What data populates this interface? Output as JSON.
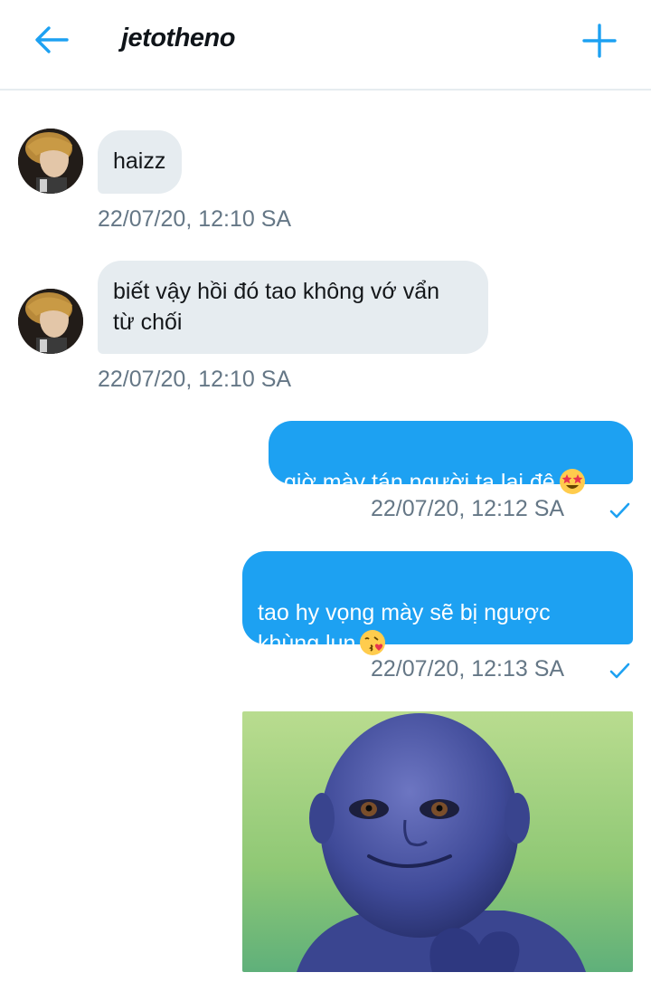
{
  "header": {
    "title": "jetotheno",
    "back_icon": "arrow-left-icon",
    "add_icon": "plus-icon"
  },
  "colors": {
    "accent": "#1da1f2",
    "incoming_bubble": "#e6ecf0",
    "timestamp": "#657786"
  },
  "messages": [
    {
      "direction": "incoming",
      "text": "haizz",
      "timestamp": "22/07/20, 12:10 SA"
    },
    {
      "direction": "incoming",
      "text": "biết vậy hồi đó tao không vớ vẩn\ntừ chối",
      "timestamp": "22/07/20, 12:10 SA"
    },
    {
      "direction": "outgoing",
      "text": "giờ mày tán người ta lại đê",
      "emoji": "star-struck-emoji",
      "timestamp": "22/07/20, 12:12 SA",
      "status_icon": "check-icon"
    },
    {
      "direction": "outgoing",
      "text": "tao hy vọng mày sẽ bị ngược\nkhùng lun",
      "emoji": "kissing-heart-emoji",
      "timestamp": "22/07/20, 12:13 SA",
      "status_icon": "check-icon"
    },
    {
      "direction": "outgoing",
      "type": "image",
      "image": "blue-character-meme-image"
    }
  ]
}
